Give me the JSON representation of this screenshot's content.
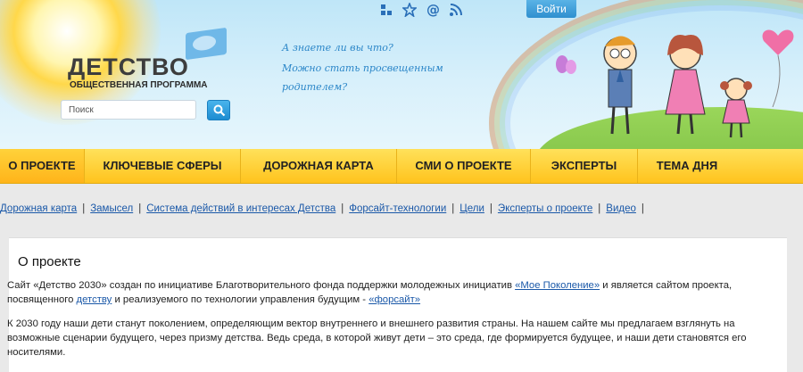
{
  "header": {
    "logo_title": "ДЕТСТВО",
    "logo_subtitle": "ОБЩЕСТВЕННАЯ ПРОГРАММА",
    "search_placeholder": "Поиск",
    "login_label": "Войти",
    "tagline": [
      "А знаете ли вы что?",
      "Можно стать просвещенным",
      "родителем?"
    ],
    "social_icons": [
      "share-icon",
      "star-icon",
      "email-icon",
      "rss-icon"
    ]
  },
  "nav": {
    "items": [
      {
        "label": "О ПРОЕКТЕ",
        "active": true
      },
      {
        "label": "КЛЮЧЕВЫЕ СФЕРЫ"
      },
      {
        "label": "ДОРОЖНАЯ КАРТА"
      },
      {
        "label": "СМИ О ПРОЕКТЕ"
      },
      {
        "label": "ЭКСПЕРТЫ"
      },
      {
        "label": "ТЕМА ДНЯ"
      }
    ]
  },
  "subnav": {
    "links": [
      "Дорожная карта",
      "Замысел",
      "Система действий в интересах Детства",
      "Форсайт-технологии",
      "Цели",
      "Эксперты о проекте",
      "Видео"
    ],
    "separator": "|"
  },
  "content": {
    "title": "О проекте",
    "p1_a": "Сайт «Детство 2030»  создан по инициативе Благотворительного фонда поддержки молодежных инициатив ",
    "p1_link1": "«Мое Поколение»",
    "p1_b": " и является сайтом проекта, посвященного ",
    "p1_link2": "детству",
    "p1_c": " и реализуемого по технологии управления будущим - ",
    "p1_link3": "«форсайт»",
    "p2": "К 2030 году наши дети станут поколением, определяющим вектор внутреннего и внешнего развития страны. На нашем сайте мы предлагаем взглянуть на возможные сценарии будущего, через призму детства. Ведь среда, в которой живут дети – это среда, где формируется будущее, и наши дети становятся его носителями."
  },
  "colors": {
    "nav_bg": "#ffc31d",
    "link": "#1a58a8",
    "accent_blue": "#2f8fcf"
  }
}
